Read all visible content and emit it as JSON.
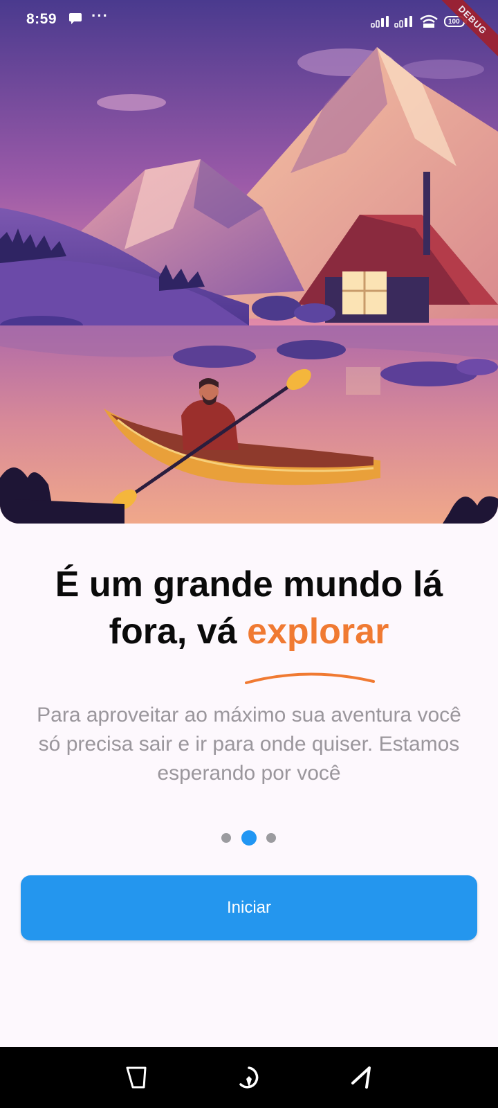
{
  "status_bar": {
    "time": "8:59",
    "more_indicator": "···",
    "battery_level": "100",
    "icons": [
      "chat-icon",
      "signal-icon",
      "signal-icon",
      "wifi-icon",
      "battery-icon"
    ]
  },
  "debug_banner": {
    "label": "DEBUG"
  },
  "illustration": {
    "subject": "kayaker-on-lake-with-mountains-and-cabin"
  },
  "onboarding": {
    "title_prefix": "É um grande mundo lá fora, vá ",
    "title_accent": "explorar",
    "subtitle": "Para aproveitar ao máximo sua aventura você só precisa sair e ir para onde quiser. Estamos esperando por você",
    "page_indicator": {
      "total": 3,
      "active": 2
    },
    "start_button_label": "Iniciar"
  },
  "colors": {
    "accent": "#f07a32",
    "primary": "#2496ee",
    "active_dot": "#2196f3",
    "inactive_dot": "#9b9b9f",
    "background": "#fdf8fd"
  },
  "nav_bar": {
    "icons": [
      "back-icon",
      "home-icon",
      "recents-icon"
    ]
  }
}
